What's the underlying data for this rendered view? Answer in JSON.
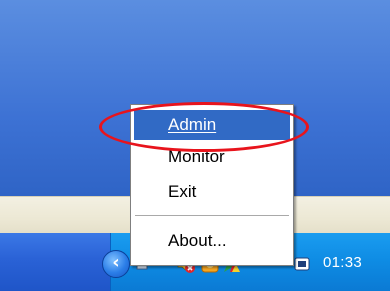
{
  "menu": {
    "items": [
      {
        "label": "Admin",
        "selected": true
      },
      {
        "label": "Monitor",
        "selected": false
      },
      {
        "label": "Exit",
        "selected": false
      },
      {
        "label": "About...",
        "selected": false
      }
    ]
  },
  "tray": {
    "clock": "01:33",
    "chevron": "‹",
    "icons": [
      "network-icon",
      "volume-muted-icon",
      "antivirus-icon",
      "app-icon",
      "settings-icon"
    ]
  },
  "colors": {
    "selection": "#316ac5",
    "highlight_ring": "#e8141c",
    "taskbar": "#2a62d6",
    "tray": "#0e8be3"
  }
}
